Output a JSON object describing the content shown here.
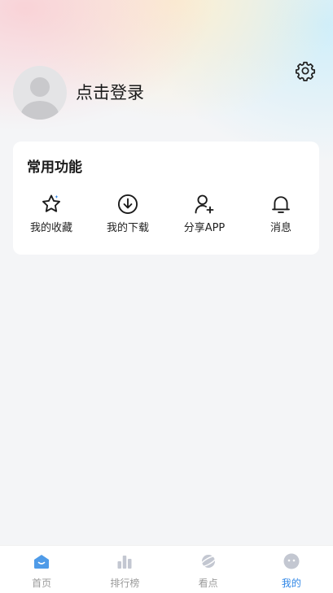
{
  "profile": {
    "login_text": "点击登录"
  },
  "common": {
    "title": "常用功能",
    "items": [
      {
        "label": "我的收藏",
        "icon": "star-icon"
      },
      {
        "label": "我的下载",
        "icon": "download-icon"
      },
      {
        "label": "分享APP",
        "icon": "add-user-icon"
      },
      {
        "label": "消息",
        "icon": "bell-icon"
      }
    ]
  },
  "tabbar": {
    "active_color": "#2f86e6",
    "inactive_color": "#9a9a9a",
    "items": [
      {
        "label": "首页",
        "icon": "home-icon",
        "active": false
      },
      {
        "label": "排行榜",
        "icon": "bar-chart-icon",
        "active": false
      },
      {
        "label": "看点",
        "icon": "planet-icon",
        "active": false
      },
      {
        "label": "我的",
        "icon": "face-icon",
        "active": true
      }
    ]
  }
}
